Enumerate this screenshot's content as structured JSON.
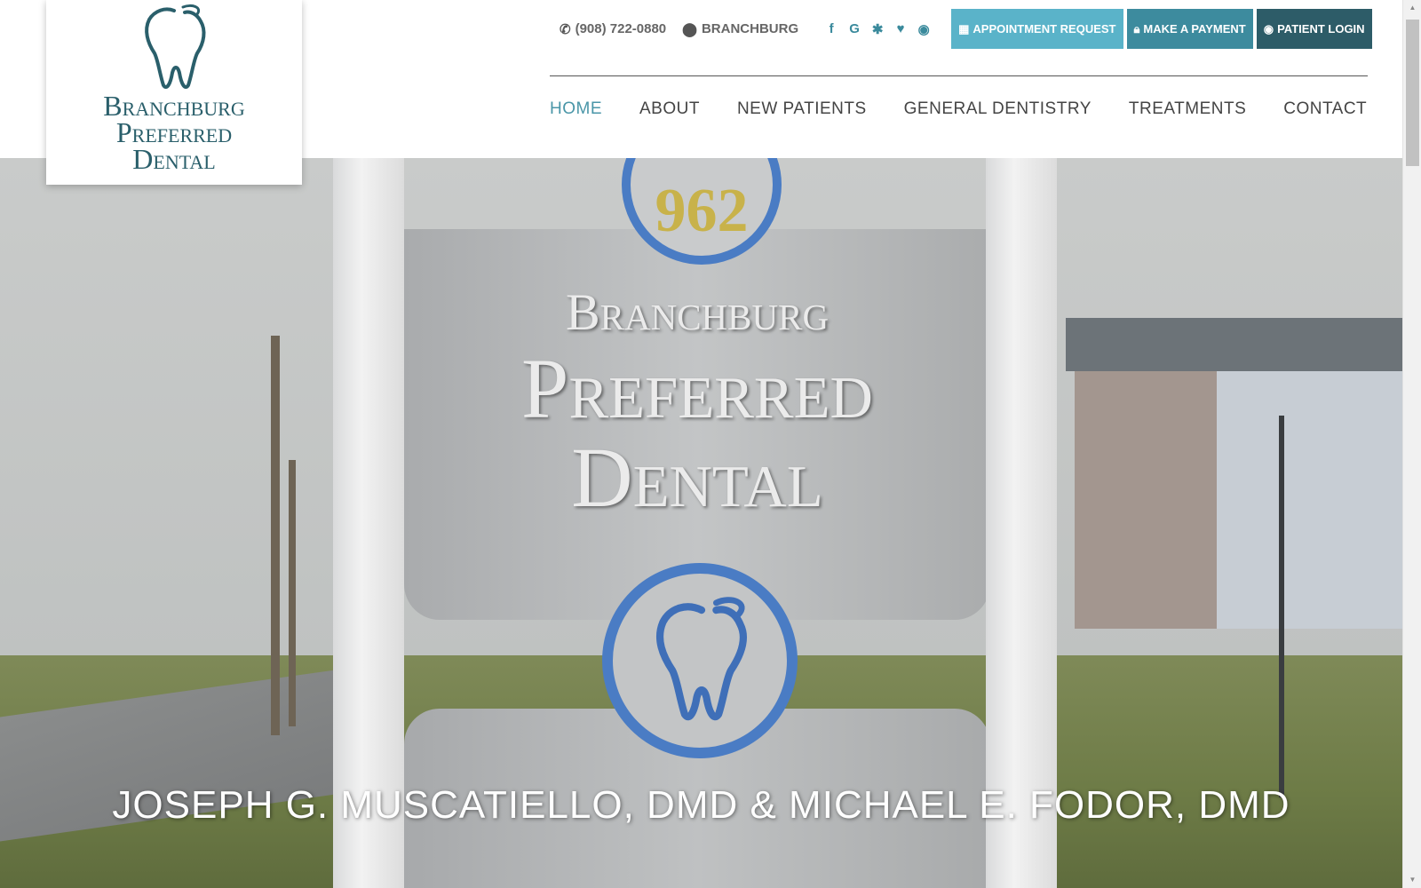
{
  "logo": {
    "line1": "Branchburg",
    "line2": "Preferred",
    "line3": "Dental"
  },
  "topbar": {
    "phone": "(908) 722-0880",
    "location": "BRANCHBURG",
    "socials": [
      {
        "icon": "facebook-icon",
        "glyph": "f"
      },
      {
        "icon": "google-icon",
        "glyph": "G"
      },
      {
        "icon": "yelp-icon",
        "glyph": "✱"
      },
      {
        "icon": "healthgrades-icon",
        "glyph": "♥"
      },
      {
        "icon": "rss-icon",
        "glyph": "◉"
      }
    ],
    "buttons": {
      "appointment": "APPOINTMENT REQUEST",
      "payment": "MAKE A PAYMENT",
      "login": "PATIENT LOGIN"
    }
  },
  "nav": {
    "items": [
      "HOME",
      "ABOUT",
      "NEW PATIENTS",
      "GENERAL DENTISTRY",
      "TREATMENTS",
      "CONTACT"
    ],
    "active": "HOME"
  },
  "hero": {
    "sign_number": "962",
    "sign_line1": "Branchburg",
    "sign_line2": "Preferred",
    "sign_line3": "Dental",
    "caption": "JOSEPH G. MUSCATIELLO, DMD & MICHAEL E. FODOR, DMD"
  },
  "colors": {
    "brand_teal": "#2a5f6b",
    "active_nav": "#4a96a8",
    "appointment_btn": "#5ab3c9",
    "payment_btn": "#3d8b9e",
    "login_btn": "#2d5c68"
  }
}
